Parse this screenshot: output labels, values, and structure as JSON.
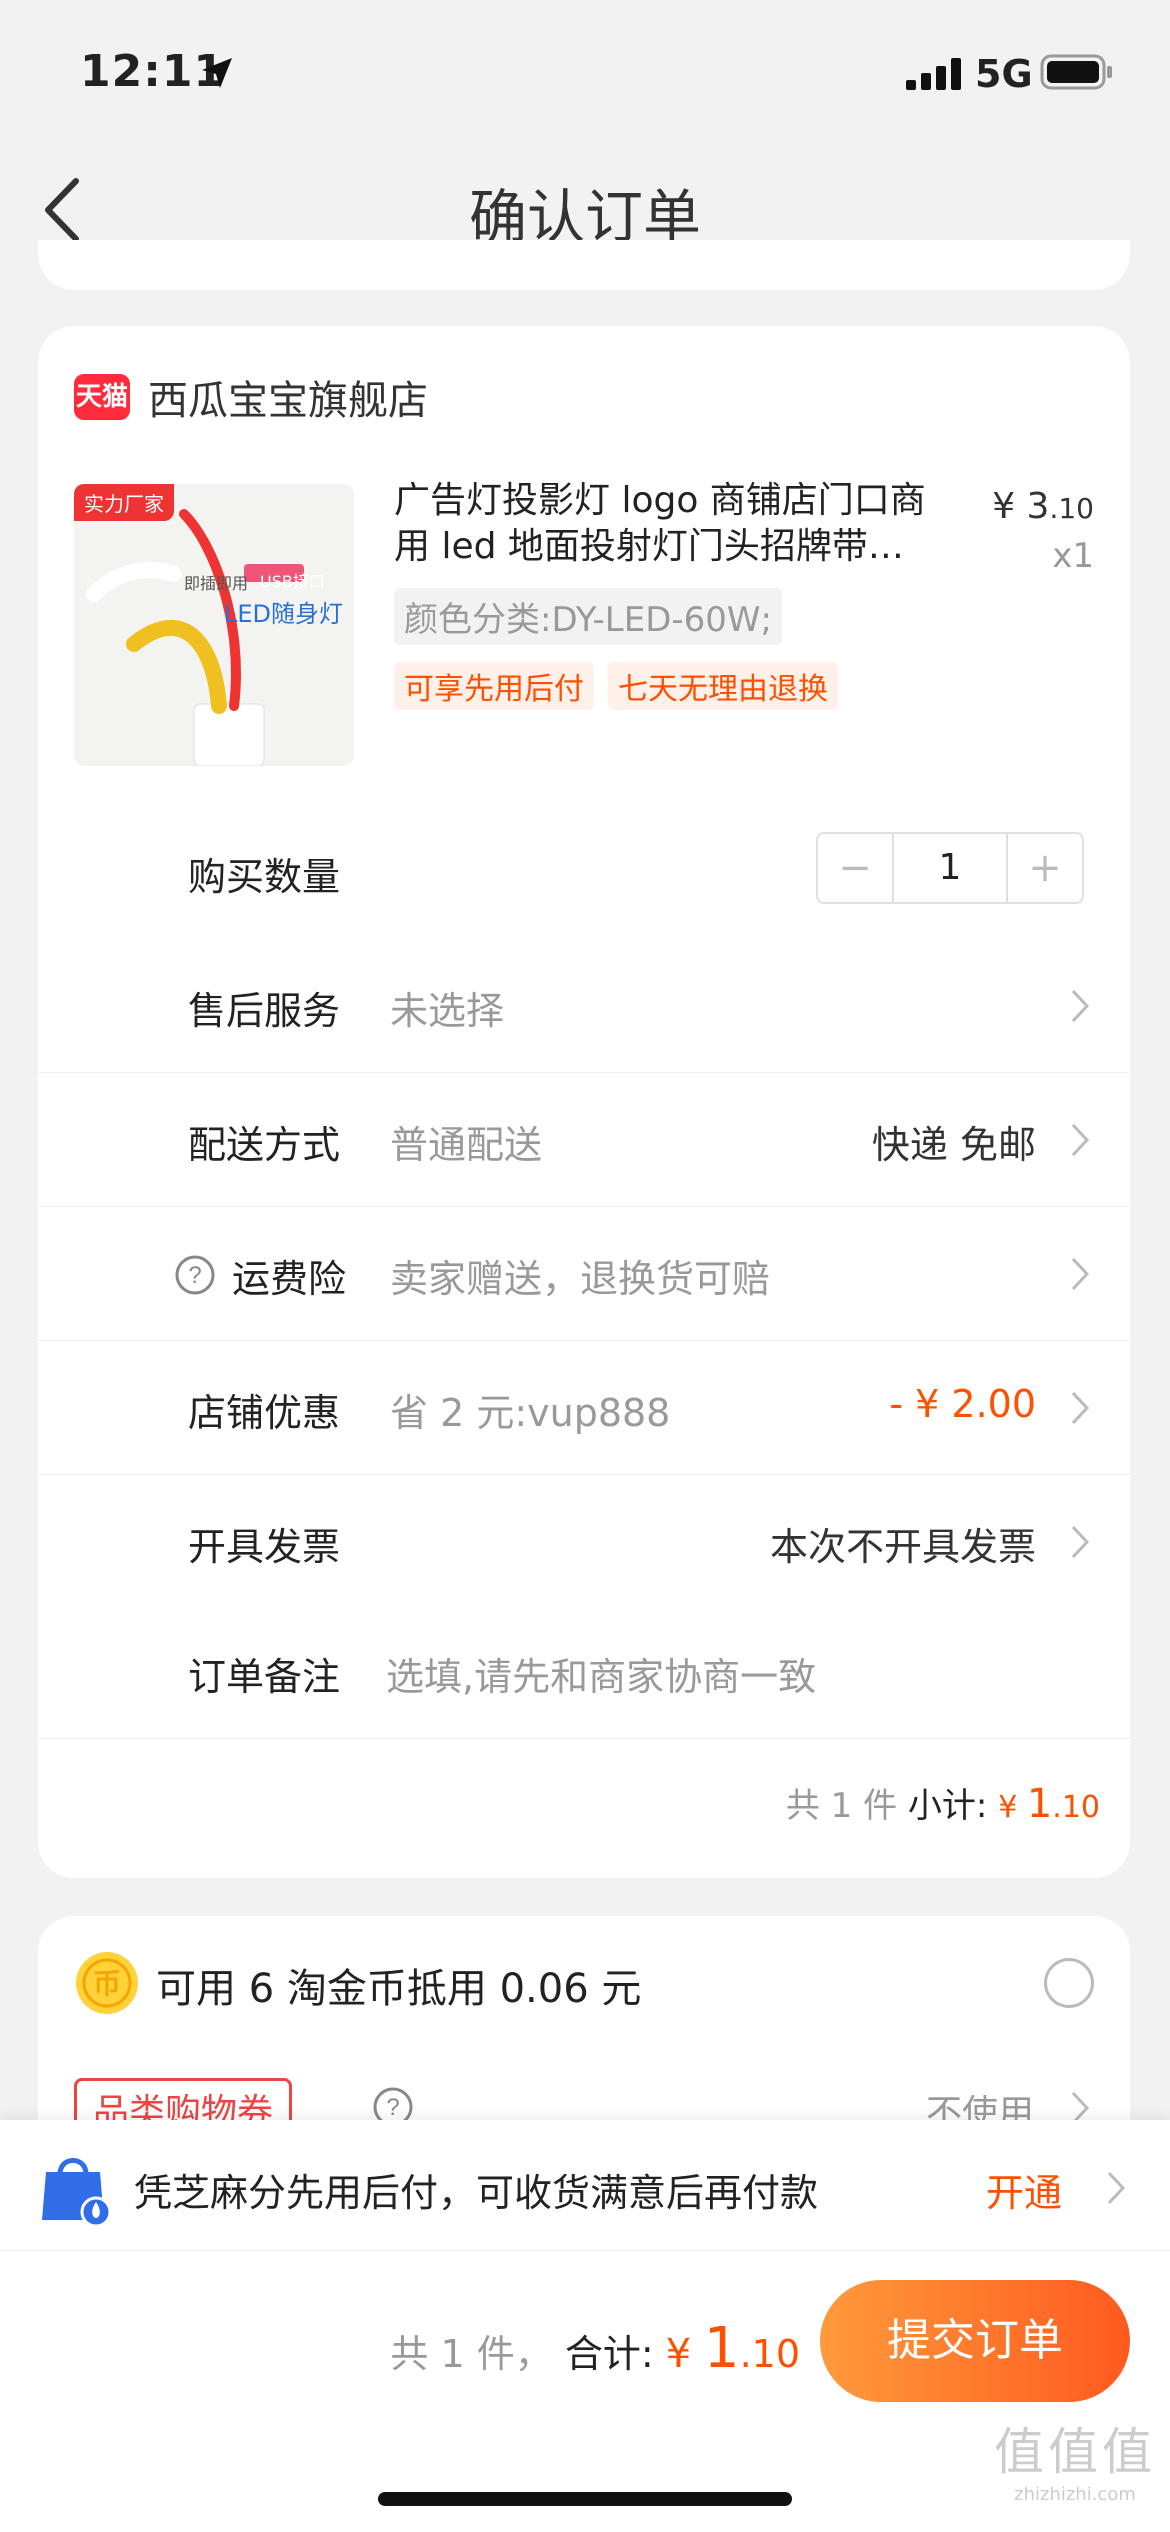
{
  "status_bar": {
    "time": "12:11",
    "network": "5G"
  },
  "nav": {
    "title": "确认订单"
  },
  "shop": {
    "badge": "天猫",
    "name": "西瓜宝宝旗舰店"
  },
  "product": {
    "image_badge": "实力厂家",
    "image_text1": "即插即用",
    "image_text2": "USB接口",
    "image_text3": "LED随身灯",
    "title": "广告灯投影灯 logo 商铺店门口商用 led 地面投射灯门头招牌带…",
    "price_symbol": "¥ 3",
    "price_decimal": ".10",
    "qty_x": "x1",
    "sku": "颜色分类:DY-LED-60W;",
    "tags": [
      "可享先用后付",
      "七天无理由退换"
    ]
  },
  "rows": {
    "quantity": {
      "label": "购买数量",
      "value": "1",
      "minus": "−",
      "plus": "+"
    },
    "after_sale": {
      "label": "售后服务",
      "sub": "未选择"
    },
    "shipping": {
      "label": "配送方式",
      "sub": "普通配送",
      "right": "快递 免邮"
    },
    "freight_insurance": {
      "label": "运费险",
      "sub": "卖家赠送，退换货可赔"
    },
    "store_discount": {
      "label": "店铺优惠",
      "sub": "省 2 元:vup888",
      "right": "- ¥ 2.00"
    },
    "invoice": {
      "label": "开具发票",
      "right": "本次不开具发票"
    },
    "note": {
      "label": "订单备注",
      "placeholder": "选填,请先和商家协商一致"
    }
  },
  "subtotal": {
    "count": "共 1 件",
    "label": "小计:",
    "symbol": "¥ ",
    "int": "1",
    "dec": ".10"
  },
  "coins": {
    "text": "可用 6 淘金币抵用 0.06 元"
  },
  "coupon": {
    "tag": "品类购物券",
    "right": "不使用"
  },
  "promo": {
    "text": "凭芝麻分先用后付，可收货满意后再付款",
    "action": "开通"
  },
  "total": {
    "count": "共 1 件，",
    "label": "合计:",
    "symbol": "¥ ",
    "int": "1",
    "dec": ".10"
  },
  "submit": {
    "label": "提交订单"
  },
  "watermark": {
    "line1": "值值值",
    "line2": "zhizhizhi.com"
  },
  "colors": {
    "accent": "#ff5000",
    "tmall_red": "#ff2a3c"
  }
}
